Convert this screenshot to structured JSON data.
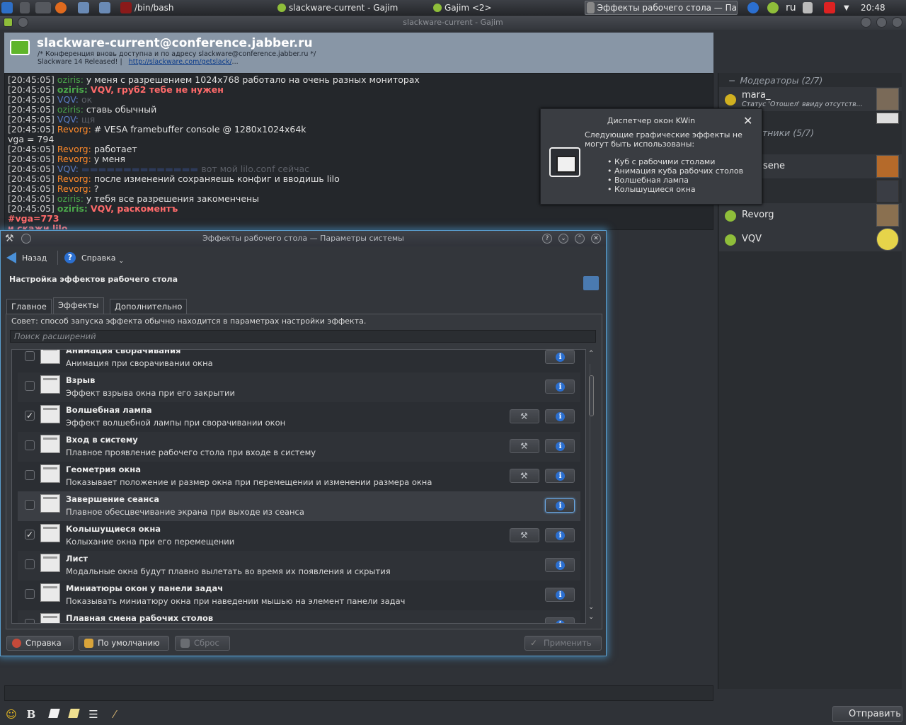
{
  "taskbar": {
    "tasks": [
      {
        "label": "/bin/bash"
      },
      {
        "label": "slackware-current - Gajim"
      },
      {
        "label": "Gajim <2>"
      },
      {
        "label": "Эффекты рабочего стола — Па"
      }
    ],
    "layout": "ru",
    "clock": "20:48"
  },
  "gajim": {
    "window_title": "slackware-current - Gajim",
    "room": "slackware-current@conference.jabber.ru",
    "subject_line1": "/* Конференция вновь доступна и по адресу slackware@conference.jabber.ru */",
    "subject_line2_prefix": "Slackware 14 Released! |",
    "subject_link": "http://slackware.com/getslack/",
    "subject_suffix": "...",
    "messages": [
      {
        "time": "[20:45:05]",
        "nick": "oziris:",
        "text": "у меня с разрешением 1024x768 работало на очень разных мониторах"
      },
      {
        "time": "[20:45:05]",
        "nick": "oziris:",
        "text": "VQV, груб2 тебе не нужен"
      },
      {
        "time": "[20:45:05]",
        "nick": "VQV:",
        "text": "ок"
      },
      {
        "time": "[20:45:05]",
        "nick": "oziris:",
        "text": "ставь обычный"
      },
      {
        "time": "[20:45:05]",
        "nick": "VQV:",
        "text": "щя"
      },
      {
        "time": "[20:45:05]",
        "nick": "Revorg:",
        "text": "# VESA framebuffer console @ 1280x1024x64k"
      },
      {
        "text": "vga = 794"
      },
      {
        "time": "[20:45:05]",
        "nick": "Revorg:",
        "text": "работает"
      },
      {
        "time": "[20:45:05]",
        "nick": "Revorg:",
        "text": "у меня"
      },
      {
        "time": "[20:45:05]",
        "nick": "VQV:",
        "text": "вот мой lilo.conf сейчас"
      },
      {
        "time": "[20:45:05]",
        "nick": "Revorg:",
        "text": "после изменений сохраняешь конфиг и вводишь lilo"
      },
      {
        "time": "[20:45:05]",
        "nick": "Revorg:",
        "text": "?"
      },
      {
        "time": "[20:45:05]",
        "nick": "oziris:",
        "text": "у тебя все разрешения закоменчены"
      },
      {
        "time": "[20:45:05]",
        "nick": "oziris:",
        "text": "VQV, раскоментъ"
      },
      {
        "text": "#vga=773"
      },
      {
        "text": "и скажи lilo"
      }
    ],
    "roster": {
      "moderators": "Модераторы (2/7)",
      "participants": "тники (5/7)",
      "users": [
        {
          "name": "mara_",
          "status": "Статус 'Отошел' ввиду отсутств..."
        },
        {
          "name": "sene"
        },
        {
          "name": "Revorg"
        },
        {
          "name": "VQV"
        }
      ]
    },
    "send_button": "Отправить"
  },
  "kwin_popup": {
    "title": "Диспетчер окон KWin",
    "message": "Следующие графические эффекты не могут быть использованы:",
    "effects": [
      "Куб с рабочими столами",
      "Анимация куба рабочих столов",
      "Волшебная лампа",
      "Колышущиеся окна"
    ]
  },
  "dialog": {
    "title": "Эффекты рабочего стола — Параметры системы",
    "back": "Назад",
    "help_menu": "Справка",
    "heading": "Настройка эффектов рабочего стола",
    "tabs": [
      "Главное",
      "Эффекты",
      "Дополнительно"
    ],
    "tip": "Совет: способ запуска эффекта обычно находится в параметрах настройки эффекта.",
    "search_placeholder": "Поиск расширений",
    "effects": [
      {
        "name": "Анимация сворачивания",
        "desc": "Анимация при сворачивании окна",
        "checked": false,
        "config": false
      },
      {
        "name": "Взрыв",
        "desc": "Эффект взрыва окна при его закрытии",
        "checked": false,
        "config": false
      },
      {
        "name": "Волшебная лампа",
        "desc": "Эффект волшебной лампы при сворачивании окон",
        "checked": true,
        "config": true
      },
      {
        "name": "Вход в систему",
        "desc": "Плавное проявление рабочего стола при входе в систему",
        "checked": false,
        "config": true
      },
      {
        "name": "Геометрия окна",
        "desc": "Показывает положение и размер окна при перемещении и изменении размера окна",
        "checked": false,
        "config": true
      },
      {
        "name": "Завершение сеанса",
        "desc": "Плавное обесцвечивание экрана при выходе из сеанса",
        "checked": false,
        "config": false
      },
      {
        "name": "Колышущиеся окна",
        "desc": "Колыхание окна при его перемещении",
        "checked": true,
        "config": true
      },
      {
        "name": "Лист",
        "desc": "Модальные окна будут плавно вылетать во время их появления и скрытия",
        "checked": false,
        "config": false
      },
      {
        "name": "Миниатюры окон у панели задач",
        "desc": "Показывать миниатюру окна при наведении мышью на элемент панели задач",
        "checked": false,
        "config": false
      },
      {
        "name": "Плавная смена рабочих столов",
        "desc": "",
        "checked": false,
        "config": false
      }
    ],
    "buttons": {
      "help": "Справка",
      "defaults": "По умолчанию",
      "reset": "Сброс",
      "apply": "Применить"
    },
    "check_mark": "✓"
  },
  "icons": {
    "info": "i",
    "wrench": "⚒",
    "close": "✕",
    "bold": "B",
    "list": "☰",
    "smile": "☺"
  }
}
